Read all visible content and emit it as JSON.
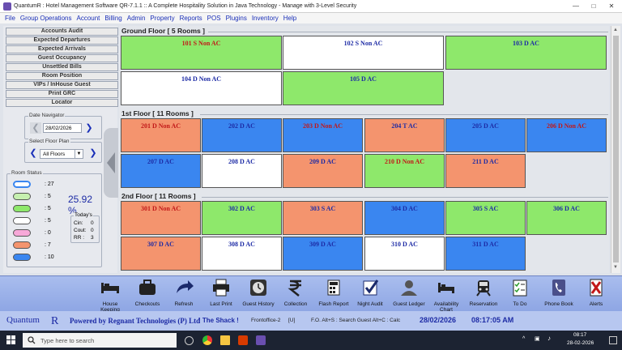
{
  "window": {
    "title": "QuantumR : Hotel Management Software QR-7.1.1  ::  A Complete Hospitality Solution in Java Technology - Manage with 3-Level Security"
  },
  "menu": [
    "File",
    "Group Operations",
    "Account",
    "Billing",
    "Admin",
    "Property",
    "Reports",
    "POS",
    "Plugins",
    "Inventory",
    "Help"
  ],
  "left_buttons": [
    "Accounts Audit",
    "Expected Departures",
    "Expected Arrivals",
    "Guest Occupancy",
    "Unsettled Bills",
    "Room Position",
    "VIPs / InHouse Guest",
    "Print GRC",
    "Locator"
  ],
  "date_navigator": {
    "title": "Date Navigator",
    "date": "28/02/2026"
  },
  "floor_plan": {
    "title": "Select Floor Plan",
    "value": "All Floors"
  },
  "room_status": {
    "title": "Room Status",
    "counts": [
      ":  27",
      ":  5",
      ":  5",
      ":  5",
      ":  0",
      ":  7",
      ":  10"
    ],
    "colors": [
      "#ffffff",
      "#9fe67d",
      "#8ee86b",
      "#ffffff",
      "#f7a8d8",
      "#f4946e",
      "#3a86f0"
    ],
    "percent": "25.92 %",
    "todays_title": "Today's",
    "cin": "Cin:",
    "cin_val": "0",
    "cout": "Cout:",
    "cout_val": "0",
    "rr": "RR :",
    "rr_val": "3"
  },
  "floors": [
    {
      "title": "Ground Floor [ 5 Rooms ]",
      "rooms": [
        {
          "label": "101 S Non AC",
          "color": "green",
          "text": "red"
        },
        {
          "label": "102 S Non AC",
          "color": "white",
          "text": "navy"
        },
        {
          "label": "103 D AC",
          "color": "green",
          "text": "navy"
        },
        {
          "label": "104 D Non AC",
          "color": "white",
          "text": "navy"
        },
        {
          "label": "105 D AC",
          "color": "green",
          "text": "navy"
        }
      ]
    },
    {
      "title": "1st Floor [ 11 Rooms ]",
      "rooms": [
        {
          "label": "201 D Non AC",
          "color": "salmon",
          "text": "red"
        },
        {
          "label": "202 D AC",
          "color": "blue",
          "text": "navy"
        },
        {
          "label": "203 D Non AC",
          "color": "blue",
          "text": "red"
        },
        {
          "label": "204 T AC",
          "color": "salmon",
          "text": "navy"
        },
        {
          "label": "205 D AC",
          "color": "blue",
          "text": "navy"
        },
        {
          "label": "206 D Non AC",
          "color": "blue",
          "text": "red"
        },
        {
          "label": "207 D AC",
          "color": "blue",
          "text": "navy"
        },
        {
          "label": "208 D AC",
          "color": "white",
          "text": "navy"
        },
        {
          "label": "209 D AC",
          "color": "salmon",
          "text": "navy"
        },
        {
          "label": "210 D Non AC",
          "color": "green",
          "text": "red"
        },
        {
          "label": "211 D AC",
          "color": "salmon",
          "text": "navy"
        }
      ]
    },
    {
      "title": "2nd Floor [ 11 Rooms ]",
      "rooms": [
        {
          "label": "301 D Non AC",
          "color": "salmon",
          "text": "red"
        },
        {
          "label": "302 D AC",
          "color": "green",
          "text": "navy"
        },
        {
          "label": "303 S AC",
          "color": "salmon",
          "text": "navy"
        },
        {
          "label": "304 D AC",
          "color": "blue",
          "text": "navy"
        },
        {
          "label": "305 S AC",
          "color": "green",
          "text": "navy"
        },
        {
          "label": "306 D AC",
          "color": "green",
          "text": "navy"
        },
        {
          "label": "307 D AC",
          "color": "salmon",
          "text": "navy"
        },
        {
          "label": "308 D AC",
          "color": "white",
          "text": "navy"
        },
        {
          "label": "309 D AC",
          "color": "blue",
          "text": "navy"
        },
        {
          "label": "310 D AC",
          "color": "white",
          "text": "navy"
        },
        {
          "label": "311 D AC",
          "color": "blue",
          "text": "navy"
        }
      ]
    }
  ],
  "toolbar": [
    {
      "label": "House Keeping",
      "icon": "bed-icon"
    },
    {
      "label": "Checkouts",
      "icon": "briefcase-icon"
    },
    {
      "label": "Refresh",
      "icon": "refresh-arrow-icon"
    },
    {
      "label": "Last Print",
      "icon": "printer-icon"
    },
    {
      "label": "Guest History",
      "icon": "clock-icon"
    },
    {
      "label": "Collection",
      "icon": "rupee-icon"
    },
    {
      "label": "Flash Report",
      "icon": "calculator-icon"
    },
    {
      "label": "Night Audit",
      "icon": "checkmark-icon"
    },
    {
      "label": "Guest Ledger",
      "icon": "person-icon"
    },
    {
      "label": "Availability Chart",
      "icon": "bed-chart-icon"
    },
    {
      "label": "Reservation",
      "icon": "train-icon"
    },
    {
      "label": "To Do",
      "icon": "checklist-icon"
    },
    {
      "label": "Phone Book",
      "icon": "phone-icon"
    },
    {
      "label": "Alerts",
      "icon": "alert-icon"
    }
  ],
  "statusbar": {
    "logo": "Quantum",
    "powered": "Powered by Regnant Technologies (P) Ltd",
    "hotel": "! The Shack !",
    "office": "Frontoffice-2",
    "user": "[U]",
    "hint": "F.O.   Alt+S : Search Guest   Alt+C : Calc",
    "date": "28/02/2026",
    "time": "08:17:05 AM"
  },
  "taskbar": {
    "search_placeholder": "Type here to search",
    "time": "08:17",
    "date": "28-02-2026"
  }
}
